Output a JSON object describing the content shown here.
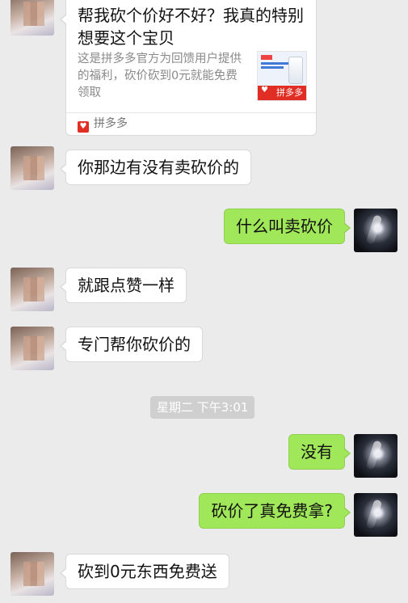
{
  "card": {
    "title": "帮我砍个价好不好？我真的特别想要这个宝贝",
    "description": "这是拼多多官方为回馈用户提供的福利，砍价砍到0元就能免费领取",
    "thumb_badge": "拼多多",
    "source": "拼多多"
  },
  "messages": [
    {
      "text": "你那边有没有卖砍价的"
    },
    {
      "text": "什么叫卖砍价"
    },
    {
      "text": "就跟点赞一样"
    },
    {
      "text": "专门帮你砍价的"
    },
    {
      "text": "没有"
    },
    {
      "text": "砍价了真免费拿?"
    },
    {
      "text": "砍到0元东西免费送"
    }
  ],
  "timestamp": "星期二 下午3:01",
  "colors": {
    "chat_background": "#ebebeb",
    "incoming_bubble": "#ffffff",
    "outgoing_bubble": "#a0e75a",
    "brand_red": "#e02e24"
  }
}
